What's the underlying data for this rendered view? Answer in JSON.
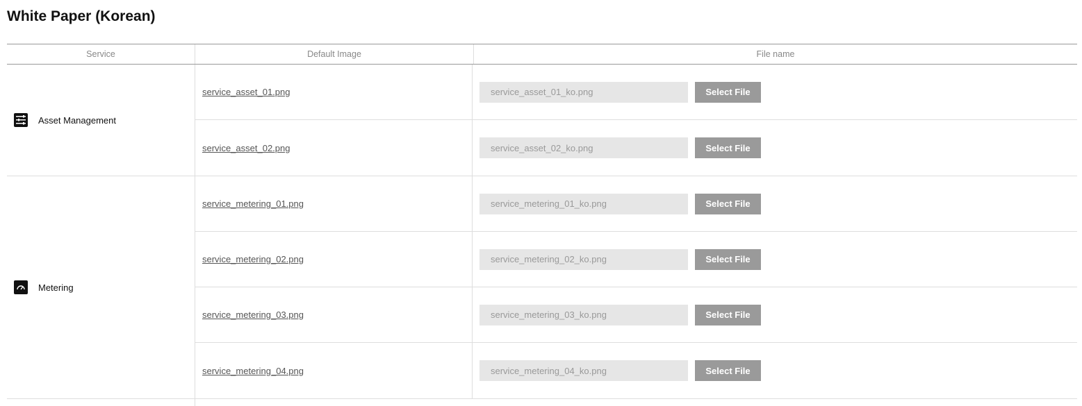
{
  "page": {
    "title": "White Paper (Korean)"
  },
  "table": {
    "headers": {
      "service": "Service",
      "default_image": "Default Image",
      "file_name": "File name"
    },
    "groups": [
      {
        "service": "Asset Management",
        "icon": "list-icon",
        "rows": [
          {
            "default_image": "service_asset_01.png",
            "file_value": "service_asset_01_ko.png",
            "button": "Select File"
          },
          {
            "default_image": "service_asset_02.png",
            "file_value": "service_asset_02_ko.png",
            "button": "Select File"
          }
        ]
      },
      {
        "service": "Metering",
        "icon": "gauge-icon",
        "rows": [
          {
            "default_image": "service_metering_01.png",
            "file_value": "service_metering_01_ko.png",
            "button": "Select File"
          },
          {
            "default_image": "service_metering_02.png",
            "file_value": "service_metering_02_ko.png",
            "button": "Select File"
          },
          {
            "default_image": "service_metering_03.png",
            "file_value": "service_metering_03_ko.png",
            "button": "Select File"
          },
          {
            "default_image": "service_metering_04.png",
            "file_value": "service_metering_04_ko.png",
            "button": "Select File"
          }
        ]
      }
    ]
  },
  "colors": {
    "button_bg": "#9a9a9a",
    "input_bg": "#e6e6e6",
    "border": "#dddddd"
  }
}
